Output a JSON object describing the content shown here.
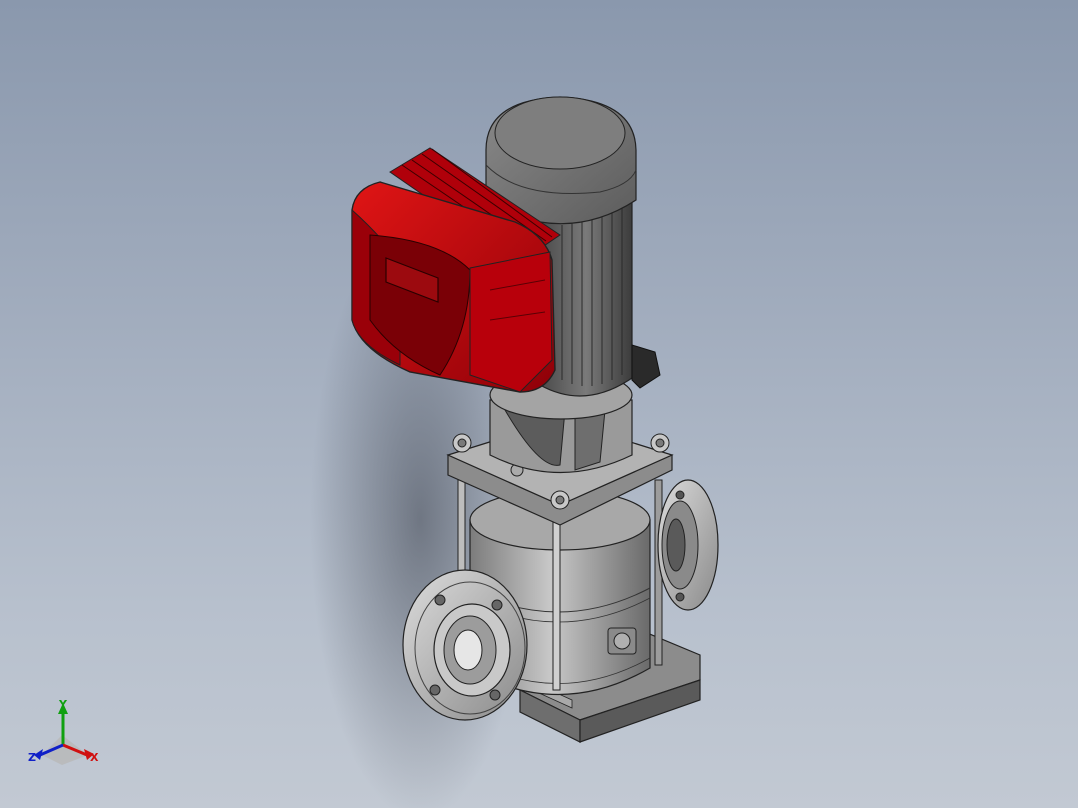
{
  "viewport": {
    "background_top": "#8a98ad",
    "background_bottom": "#c2c9d3"
  },
  "model": {
    "drive_color": "#c8000a",
    "motor_color": "#6f6f6f",
    "body_color": "#9a9a9a"
  },
  "triad": {
    "x_label": "X",
    "y_label": "Y",
    "z_label": "Z",
    "x_color": "#d01010",
    "y_color": "#10a010",
    "z_color": "#1020c8"
  }
}
